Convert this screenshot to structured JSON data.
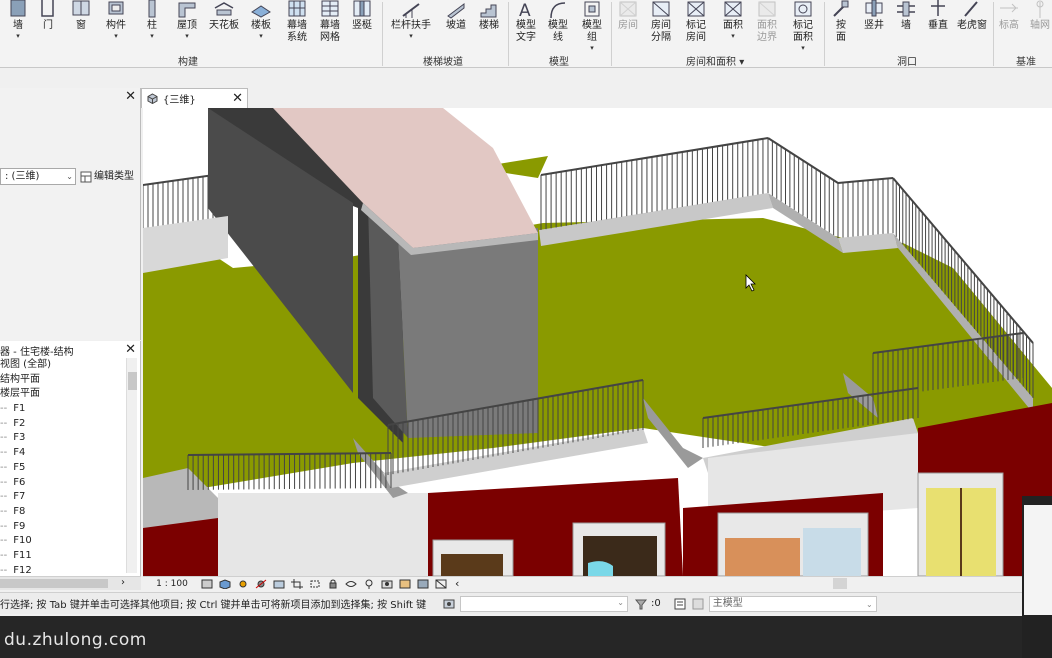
{
  "ribbon": {
    "groups": {
      "build": "构建",
      "stairs": "楼梯坡道",
      "model": "模型",
      "rooms": "房间和面积",
      "opening": "洞口",
      "datum": "基准"
    },
    "tools": {
      "wall": "墙",
      "door": "门",
      "window": "窗",
      "component": "构件",
      "column": "柱",
      "roof": "屋顶",
      "ceiling": "天花板",
      "floor": "楼板",
      "curtain_system": "幕墙\n系统",
      "curtain_grid": "幕墙\n网格",
      "mullion": "竖梃",
      "railing": "栏杆扶手",
      "ramp": "坡道",
      "stair": "楼梯",
      "model_text": "模型\n文字",
      "model_line": "模型\n线",
      "model_group": "模型\n组",
      "room": "房间",
      "room_separator": "房间\n分隔",
      "tag_room": "标记\n房间",
      "area": "面积",
      "area_boundary": "面积\n边界",
      "tag_area": "标记\n面积",
      "by_face": "按\n面",
      "shaft": "竖井",
      "opening_wall": "墙",
      "vertical": "垂直",
      "dormer": "老虎窗",
      "level": "标高",
      "grid": "轴网"
    }
  },
  "properties": {
    "view_selector": ": (三维)",
    "edit_type": "编辑类型"
  },
  "browser": {
    "title": "器 - 住宅楼-结构",
    "items": [
      "视图 (全部)",
      "结构平面",
      "楼层平面",
      "F1",
      "F2",
      "F3",
      "F4",
      "F5",
      "F6",
      "F7",
      "F8",
      "F9",
      "F10",
      "F11",
      "F12"
    ]
  },
  "view": {
    "tab_title": "{三维}",
    "scale": "1 : 100"
  },
  "status": {
    "message": "行选择; 按 Tab 键并单击可选择其他项目; 按 Ctrl 键并单击可将新项目添加到选择集; 按 Shift 键",
    "count": ":0",
    "main_model": "主模型"
  },
  "watermark": "du.zhulong.com",
  "colors": {
    "floor_olive": "#8a9a00",
    "wall_red": "#7b0000",
    "wall_dark": "#3c3c3c",
    "roof_pink": "#e2c8c4",
    "railing": "#555555"
  }
}
